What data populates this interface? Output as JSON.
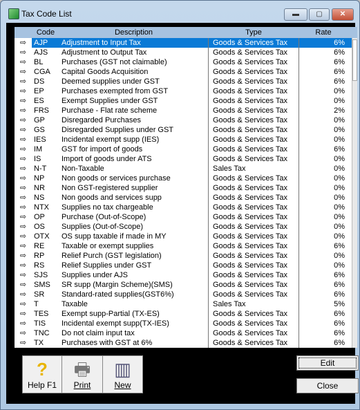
{
  "window": {
    "title": "Tax Code List",
    "minimize": "▬",
    "maximize": "▢",
    "close": "✕"
  },
  "grid": {
    "headers": {
      "code": "Code",
      "description": "Description",
      "type": "Type",
      "rate": "Rate"
    },
    "rows": [
      {
        "code": "AJP",
        "description": "Adjustment to Input Tax",
        "type": "Goods & Services Tax",
        "rate": "6%"
      },
      {
        "code": "AJS",
        "description": "Adjustment to Output Tax",
        "type": "Goods & Services Tax",
        "rate": "6%"
      },
      {
        "code": "BL",
        "description": "Purchases (GST not claimable)",
        "type": "Goods & Services Tax",
        "rate": "6%"
      },
      {
        "code": "CGA",
        "description": "Capital Goods Acquisition",
        "type": "Goods & Services Tax",
        "rate": "6%"
      },
      {
        "code": "DS",
        "description": "Deemed supplies under GST",
        "type": "Goods & Services Tax",
        "rate": "6%"
      },
      {
        "code": "EP",
        "description": "Purchases exempted from GST",
        "type": "Goods & Services Tax",
        "rate": "0%"
      },
      {
        "code": "ES",
        "description": "Exempt Supplies under GST",
        "type": "Goods & Services Tax",
        "rate": "0%"
      },
      {
        "code": "FRS",
        "description": "Purchase - Flat rate scheme",
        "type": "Goods & Services Tax",
        "rate": "2%"
      },
      {
        "code": "GP",
        "description": "Disregarded Purchases",
        "type": "Goods & Services Tax",
        "rate": "0%"
      },
      {
        "code": "GS",
        "description": "Disregarded Supplies under GST",
        "type": "Goods & Services Tax",
        "rate": "0%"
      },
      {
        "code": "IES",
        "description": "Incidental exempt supp (IES)",
        "type": "Goods & Services Tax",
        "rate": "0%"
      },
      {
        "code": "IM",
        "description": "GST for import of goods",
        "type": "Goods & Services Tax",
        "rate": "6%"
      },
      {
        "code": "IS",
        "description": "Import of goods under ATS",
        "type": "Goods & Services Tax",
        "rate": "0%"
      },
      {
        "code": "N-T",
        "description": "Non-Taxable",
        "type": "Sales Tax",
        "rate": "0%"
      },
      {
        "code": "NP",
        "description": "Non goods or services purchase",
        "type": "Goods & Services Tax",
        "rate": "0%"
      },
      {
        "code": "NR",
        "description": "Non GST-registered supplier",
        "type": "Goods & Services Tax",
        "rate": "0%"
      },
      {
        "code": "NS",
        "description": "Non goods and services supp",
        "type": "Goods & Services Tax",
        "rate": "0%"
      },
      {
        "code": "NTX",
        "description": "Supplies no tax chargeable",
        "type": "Goods & Services Tax",
        "rate": "0%"
      },
      {
        "code": "OP",
        "description": "Purchase (Out-of-Scope)",
        "type": "Goods & Services Tax",
        "rate": "0%"
      },
      {
        "code": "OS",
        "description": "Supplies (Out-of-Scope)",
        "type": "Goods & Services Tax",
        "rate": "0%"
      },
      {
        "code": "OTX",
        "description": "OS supp taxable if made in MY",
        "type": "Goods & Services Tax",
        "rate": "0%"
      },
      {
        "code": "RE",
        "description": "Taxable or exempt supplies",
        "type": "Goods & Services Tax",
        "rate": "6%"
      },
      {
        "code": "RP",
        "description": "Relief Purch (GST legislation)",
        "type": "Goods & Services Tax",
        "rate": "0%"
      },
      {
        "code": "RS",
        "description": "Relief Supplies under GST",
        "type": "Goods & Services Tax",
        "rate": "0%"
      },
      {
        "code": "SJS",
        "description": "Supplies under AJS",
        "type": "Goods & Services Tax",
        "rate": "6%"
      },
      {
        "code": "SMS",
        "description": "SR supp (Margin Scheme)(SMS)",
        "type": "Goods & Services Tax",
        "rate": "6%"
      },
      {
        "code": "SR",
        "description": "Standard-rated supplies(GST6%)",
        "type": "Goods & Services Tax",
        "rate": "6%"
      },
      {
        "code": "T",
        "description": "Taxable",
        "type": "Sales Tax",
        "rate": "5%"
      },
      {
        "code": "TES",
        "description": "Exempt supp-Partial (TX-ES)",
        "type": "Goods & Services Tax",
        "rate": "6%"
      },
      {
        "code": "TIS",
        "description": "Incidental exempt supp(TX-IES)",
        "type": "Goods & Services Tax",
        "rate": "6%"
      },
      {
        "code": "TNC",
        "description": "Do not claim input tax",
        "type": "Goods & Services Tax",
        "rate": "6%"
      },
      {
        "code": "TX",
        "description": "Purchases with GST at 6%",
        "type": "Goods & Services Tax",
        "rate": "6%"
      }
    ],
    "row_icon": "⇨",
    "selected_index": 0
  },
  "toolbar": {
    "help": "Help F1",
    "print": "Print",
    "new": "New",
    "help_icon": "?",
    "print_icon": "🖶",
    "new_icon": "▥"
  },
  "buttons": {
    "edit": "Edit",
    "close": "Close"
  },
  "colors": {
    "selection": "#0a7ad6",
    "header": "#a6c2e0"
  }
}
